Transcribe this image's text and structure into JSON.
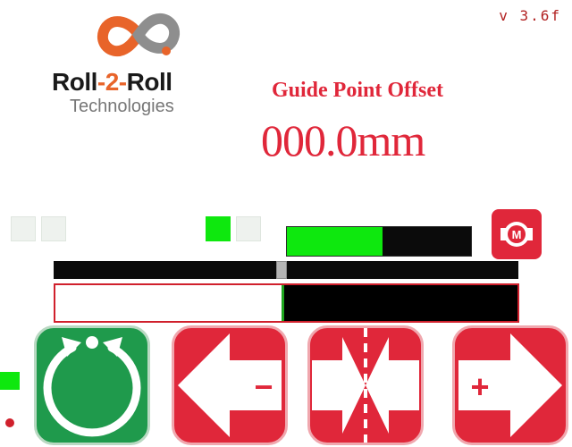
{
  "brand": {
    "name_part1": "Roll",
    "name_dash1": "-",
    "name_part2": "2",
    "name_dash2": "-",
    "name_part3": "Roll",
    "subtitle": "Technologies"
  },
  "version": "v 3.6f",
  "offset": {
    "title": "Guide Point Offset",
    "value": "000.0mm"
  },
  "level_bar": {
    "fill_fraction": 0.52
  },
  "track_bar": {
    "handle_fraction": 0.49
  },
  "position_bar": {
    "white_fraction": 0.49
  },
  "motor": {
    "label": "M"
  },
  "buttons": {
    "minus_label": "−",
    "plus_label": "+"
  },
  "colors": {
    "brand_orange": "#e8642a",
    "accent_red": "#e0273a",
    "active_green": "#0ee80e",
    "auto_green": "#1f9a4c"
  },
  "icons": [
    "logo-icon",
    "motor-icon",
    "auto-circle-icon",
    "arrow-left-icon",
    "center-icon",
    "arrow-right-icon"
  ]
}
